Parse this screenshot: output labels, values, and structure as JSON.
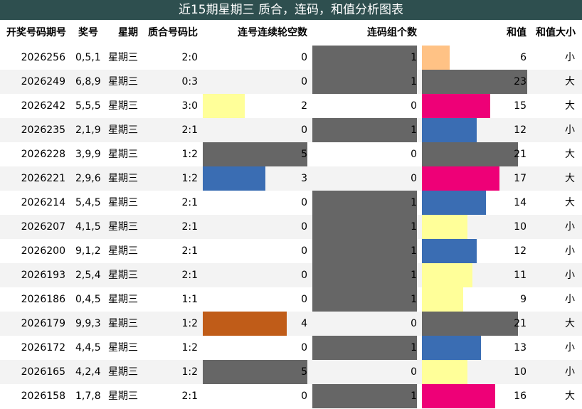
{
  "title": "近15期星期三 质合，连码，和值分析图表",
  "columns": {
    "period": "开奖号码期号",
    "number": "奖号",
    "weekday": "星期",
    "ratio": "质合号码比",
    "gap": "连号连续轮空数",
    "consec": "连码组个数",
    "sum": "和值",
    "size": "和值大小"
  },
  "colors": {
    "title_bg": "#2e4f4f",
    "gray": "#666666",
    "yellow": "#ffff99",
    "magenta": "#ee0077",
    "blue": "#3a6db3",
    "orange": "#c05c18",
    "peach": "#ffc285"
  },
  "chart_data": {
    "type": "table",
    "rows": [
      {
        "period": "2026256",
        "number": "0,5,1",
        "weekday": "星期三",
        "ratio": "2:0",
        "gap": 0,
        "gap_color": "",
        "consec": 1,
        "sum": 6,
        "sum_color": "#ffc285",
        "size": "小"
      },
      {
        "period": "2026249",
        "number": "6,8,9",
        "weekday": "星期三",
        "ratio": "0:3",
        "gap": 0,
        "gap_color": "",
        "consec": 1,
        "sum": 23,
        "sum_color": "#666666",
        "size": "大"
      },
      {
        "period": "2026242",
        "number": "5,5,5",
        "weekday": "星期三",
        "ratio": "3:0",
        "gap": 2,
        "gap_color": "#ffff99",
        "consec": 0,
        "sum": 15,
        "sum_color": "#ee0077",
        "size": "大"
      },
      {
        "period": "2026235",
        "number": "2,1,9",
        "weekday": "星期三",
        "ratio": "2:1",
        "gap": 0,
        "gap_color": "",
        "consec": 1,
        "sum": 12,
        "sum_color": "#3a6db3",
        "size": "小"
      },
      {
        "period": "2026228",
        "number": "3,9,9",
        "weekday": "星期三",
        "ratio": "1:2",
        "gap": 5,
        "gap_color": "#666666",
        "consec": 0,
        "sum": 21,
        "sum_color": "#666666",
        "size": "大"
      },
      {
        "period": "2026221",
        "number": "2,9,6",
        "weekday": "星期三",
        "ratio": "1:2",
        "gap": 3,
        "gap_color": "#3a6db3",
        "consec": 0,
        "sum": 17,
        "sum_color": "#ee0077",
        "size": "大"
      },
      {
        "period": "2026214",
        "number": "5,4,5",
        "weekday": "星期三",
        "ratio": "2:1",
        "gap": 0,
        "gap_color": "",
        "consec": 1,
        "sum": 14,
        "sum_color": "#3a6db3",
        "size": "大"
      },
      {
        "period": "2026207",
        "number": "4,1,5",
        "weekday": "星期三",
        "ratio": "2:1",
        "gap": 0,
        "gap_color": "",
        "consec": 1,
        "sum": 10,
        "sum_color": "#ffff99",
        "size": "小"
      },
      {
        "period": "2026200",
        "number": "9,1,2",
        "weekday": "星期三",
        "ratio": "2:1",
        "gap": 0,
        "gap_color": "",
        "consec": 1,
        "sum": 12,
        "sum_color": "#3a6db3",
        "size": "小"
      },
      {
        "period": "2026193",
        "number": "2,5,4",
        "weekday": "星期三",
        "ratio": "2:1",
        "gap": 0,
        "gap_color": "",
        "consec": 1,
        "sum": 11,
        "sum_color": "#ffff99",
        "size": "小"
      },
      {
        "period": "2026186",
        "number": "0,4,5",
        "weekday": "星期三",
        "ratio": "1:1",
        "gap": 0,
        "gap_color": "",
        "consec": 1,
        "sum": 9,
        "sum_color": "#ffff99",
        "size": "小"
      },
      {
        "period": "2026179",
        "number": "9,9,3",
        "weekday": "星期三",
        "ratio": "1:2",
        "gap": 4,
        "gap_color": "#c05c18",
        "consec": 0,
        "sum": 21,
        "sum_color": "#666666",
        "size": "大"
      },
      {
        "period": "2026172",
        "number": "4,4,5",
        "weekday": "星期三",
        "ratio": "1:2",
        "gap": 0,
        "gap_color": "",
        "consec": 1,
        "sum": 13,
        "sum_color": "#3a6db3",
        "size": "小"
      },
      {
        "period": "2026165",
        "number": "4,2,4",
        "weekday": "星期三",
        "ratio": "1:2",
        "gap": 5,
        "gap_color": "#666666",
        "consec": 0,
        "sum": 10,
        "sum_color": "#ffff99",
        "size": "小"
      },
      {
        "period": "2026158",
        "number": "1,7,8",
        "weekday": "星期三",
        "ratio": "2:1",
        "gap": 0,
        "gap_color": "",
        "consec": 1,
        "sum": 16,
        "sum_color": "#ee0077",
        "size": "大"
      }
    ]
  }
}
